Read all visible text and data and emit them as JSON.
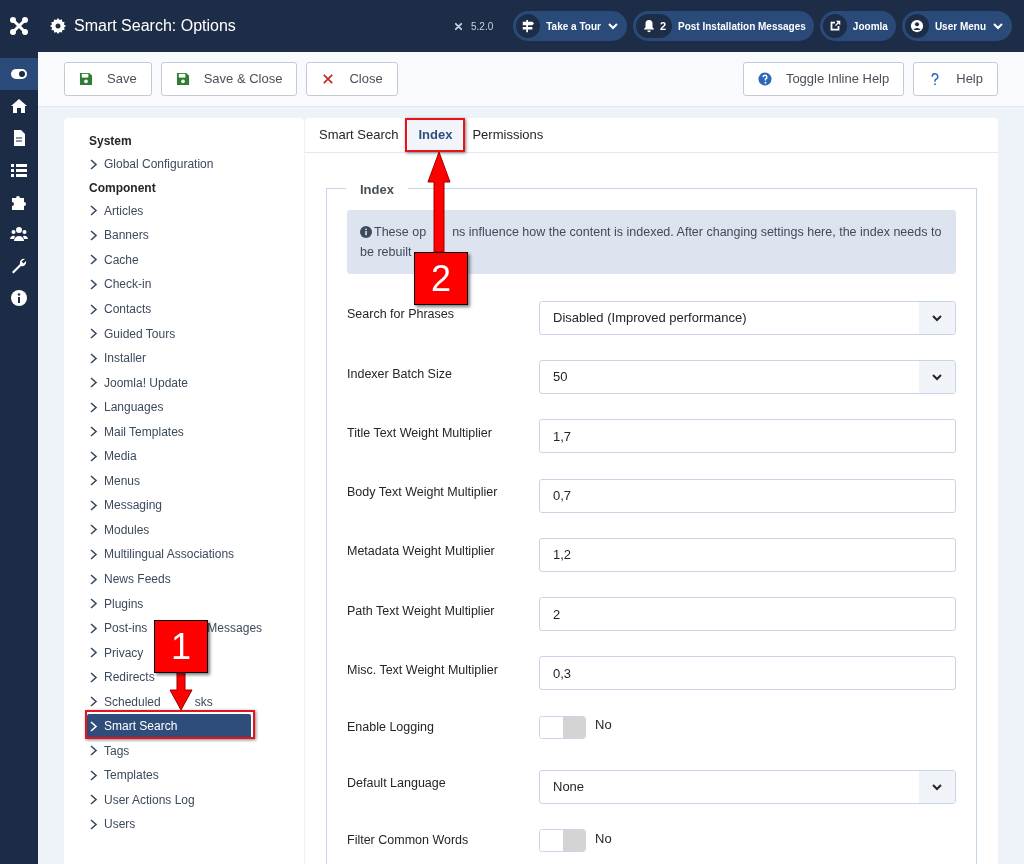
{
  "header": {
    "title": "Smart Search: Options",
    "version": "5.2.0",
    "buttons": [
      {
        "kind": "tour",
        "label": "Take a Tour"
      },
      {
        "kind": "messages",
        "count": "2",
        "label": "Post Installation Messages"
      },
      {
        "kind": "external",
        "label": "Joomla"
      },
      {
        "kind": "user",
        "label": "User Menu"
      }
    ]
  },
  "side_icons": [
    {
      "kind": "toggle",
      "selected": true
    },
    {
      "kind": "home",
      "selected": false
    },
    {
      "kind": "file",
      "selected": false
    },
    {
      "kind": "list",
      "selected": false
    },
    {
      "kind": "puzzle",
      "selected": false
    },
    {
      "kind": "users",
      "selected": false
    },
    {
      "kind": "wrench",
      "selected": false
    },
    {
      "kind": "info",
      "selected": false
    }
  ],
  "toolbar": {
    "left": [
      {
        "kind": "save",
        "label": "Save"
      },
      {
        "kind": "save",
        "label": "Save & Close"
      },
      {
        "kind": "close",
        "label": "Close"
      }
    ],
    "right": [
      {
        "kind": "help-circle",
        "label": "Toggle Inline Help"
      },
      {
        "kind": "question",
        "label": "Help"
      }
    ]
  },
  "options_nav": [
    {
      "heading": "System",
      "items": [
        {
          "label": "Global Configuration",
          "selected": false
        }
      ]
    },
    {
      "heading": "Component",
      "items": [
        {
          "label": "Articles",
          "selected": false
        },
        {
          "label": "Banners",
          "selected": false
        },
        {
          "label": "Cache",
          "selected": false
        },
        {
          "label": "Check-in",
          "selected": false
        },
        {
          "label": "Contacts",
          "selected": false
        },
        {
          "label": "Guided Tours",
          "selected": false
        },
        {
          "label": "Installer",
          "selected": false
        },
        {
          "label": "Joomla! Update",
          "selected": false
        },
        {
          "label": "Languages",
          "selected": false
        },
        {
          "label": "Mail Templates",
          "selected": false
        },
        {
          "label": "Media",
          "selected": false
        },
        {
          "label": "Menus",
          "selected": false
        },
        {
          "label": "Messaging",
          "selected": false
        },
        {
          "label": "Modules",
          "selected": false
        },
        {
          "label": "Multilingual Associations",
          "selected": false
        },
        {
          "label": "News Feeds",
          "selected": false
        },
        {
          "label": "Plugins",
          "selected": false
        },
        {
          "label": "Post-ins",
          "label_after": "Messages",
          "selected": false
        },
        {
          "label": "Privacy",
          "selected": false
        },
        {
          "label": "Redirects",
          "selected": false
        },
        {
          "label": "Scheduled",
          "label_after": "sks",
          "selected": false
        },
        {
          "label": "Smart Search",
          "selected": true
        },
        {
          "label": "Tags",
          "selected": false
        },
        {
          "label": "Templates",
          "selected": false
        },
        {
          "label": "User Actions Log",
          "selected": false
        },
        {
          "label": "Users",
          "selected": false
        }
      ]
    }
  ],
  "tabs": [
    {
      "label": "Smart Search",
      "selected": false
    },
    {
      "label": "Index",
      "selected": true
    },
    {
      "label": "Permissions",
      "selected": false
    }
  ],
  "fieldset": {
    "legend": "Index",
    "info_before": "These op",
    "info": "ns influence how the content is indexed. After changing settings here, the index needs to be rebuilt",
    "fields": [
      {
        "kind": "select",
        "label": "Search for Phrases",
        "value": "Disabled (Improved performance)"
      },
      {
        "kind": "select",
        "label": "Indexer Batch Size",
        "value": "50"
      },
      {
        "kind": "text",
        "label": "Title Text Weight Multiplier",
        "value": "1,7"
      },
      {
        "kind": "text",
        "label": "Body Text Weight Multiplier",
        "value": "0,7"
      },
      {
        "kind": "text",
        "label": "Metadata Weight Multiplier",
        "value": "1,2"
      },
      {
        "kind": "text",
        "label": "Path Text Weight Multiplier",
        "value": "2"
      },
      {
        "kind": "text",
        "label": "Misc. Text Weight Multiplier",
        "value": "0,3"
      },
      {
        "kind": "toggle",
        "label": "Enable Logging",
        "on": false,
        "value": "No"
      },
      {
        "kind": "select",
        "label": "Default Language",
        "value": "None"
      },
      {
        "kind": "toggle",
        "label": "Filter Common Words",
        "on": false,
        "value": "No"
      }
    ]
  },
  "annotations": [
    {
      "number": "1"
    },
    {
      "number": "2"
    }
  ]
}
